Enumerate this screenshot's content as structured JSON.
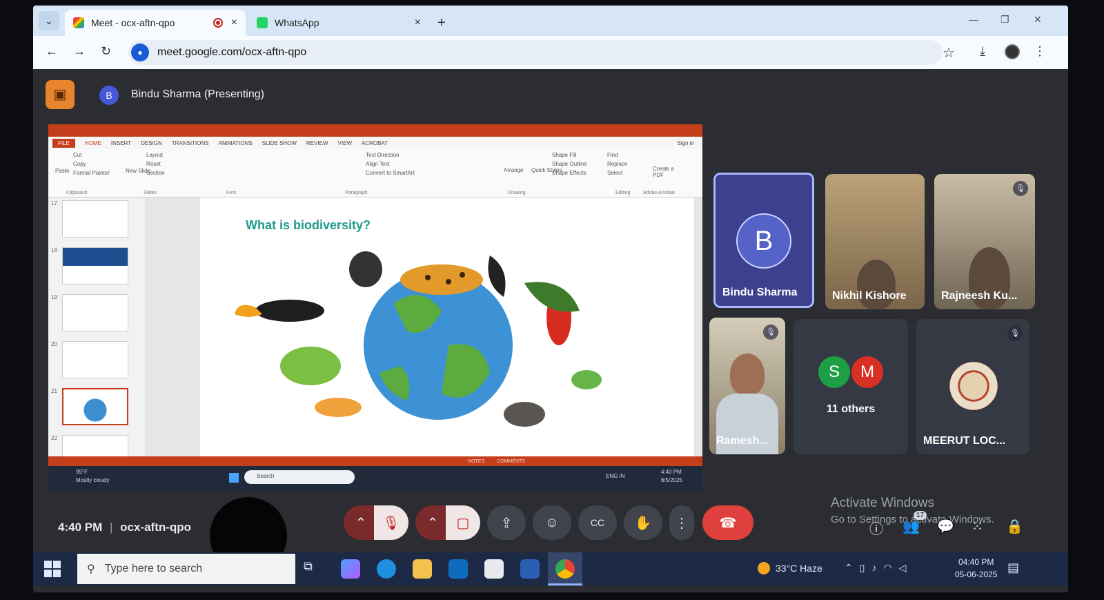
{
  "browser": {
    "tabs": [
      {
        "title": "Meet - ocx-aftn-qpo",
        "active": true
      },
      {
        "title": "WhatsApp",
        "active": false
      }
    ],
    "new_tab": "+",
    "close": "×",
    "url": "meet.google.com/ocx-aftn-qpo"
  },
  "meet": {
    "presenter_initial": "B",
    "presenter_label": "Bindu Sharma (Presenting)",
    "time": "4:40 PM",
    "separator": "|",
    "meeting_code": "ocx-aftn-qpo",
    "participants": [
      {
        "name": "Bindu Sharma",
        "initial": "B"
      },
      {
        "name": "Nikhil Kishore"
      },
      {
        "name": "Rajneesh Ku..."
      },
      {
        "name": "Ramesh..."
      },
      {
        "name": "MEERUT LOC..."
      }
    ],
    "others": {
      "label": "11 others",
      "initials": [
        "S",
        "M"
      ],
      "colors": [
        "#1e9e45",
        "#d93025"
      ]
    },
    "badge_count": "17",
    "colors": {
      "end_call": "#e0403d",
      "presenter_tile": "#3d3f8f",
      "present_icon": "#e8842c"
    }
  },
  "shared_screen": {
    "app_menus": [
      "FILE",
      "HOME",
      "INSERT",
      "DESIGN",
      "TRANSITIONS",
      "ANIMATIONS",
      "SLIDE SHOW",
      "REVIEW",
      "VIEW",
      "ACROBAT"
    ],
    "ribbon_items": [
      "Cut",
      "Copy",
      "Format Painter",
      "Paste",
      "Layout",
      "Reset",
      "Section",
      "New Slide",
      "Text Direction",
      "Align Text",
      "Convert to SmartArt",
      "Arrange",
      "Quick Styles",
      "Shape Fill",
      "Shape Outline",
      "Shape Effects",
      "Find",
      "Replace",
      "Select",
      "Create a PDF",
      "Sign in"
    ],
    "ribbon_groups": [
      "Clipboard",
      "Slides",
      "Font",
      "Paragraph",
      "Drawing",
      "Editing",
      "Adobe Acrobat"
    ],
    "slide_numbers": [
      "17",
      "18",
      "19",
      "20",
      "21",
      "22"
    ],
    "selected_slide": "21",
    "slide_title": "What is biodiversity?",
    "status_right": [
      "NOTES",
      "COMMENTS"
    ],
    "inner_taskbar": {
      "search": "Search",
      "weather": "95°F",
      "weather_desc": "Mostly cloudy",
      "lang": "ENG IN",
      "time": "4:40 PM",
      "date": "6/5/2025"
    }
  },
  "activation": {
    "title": "Activate Windows",
    "subtitle": "Go to Settings to activate Windows."
  },
  "taskbar": {
    "search_placeholder": "Type here to search",
    "weather": "33°C  Haze",
    "time": "04:40 PM",
    "date": "05-06-2025"
  }
}
